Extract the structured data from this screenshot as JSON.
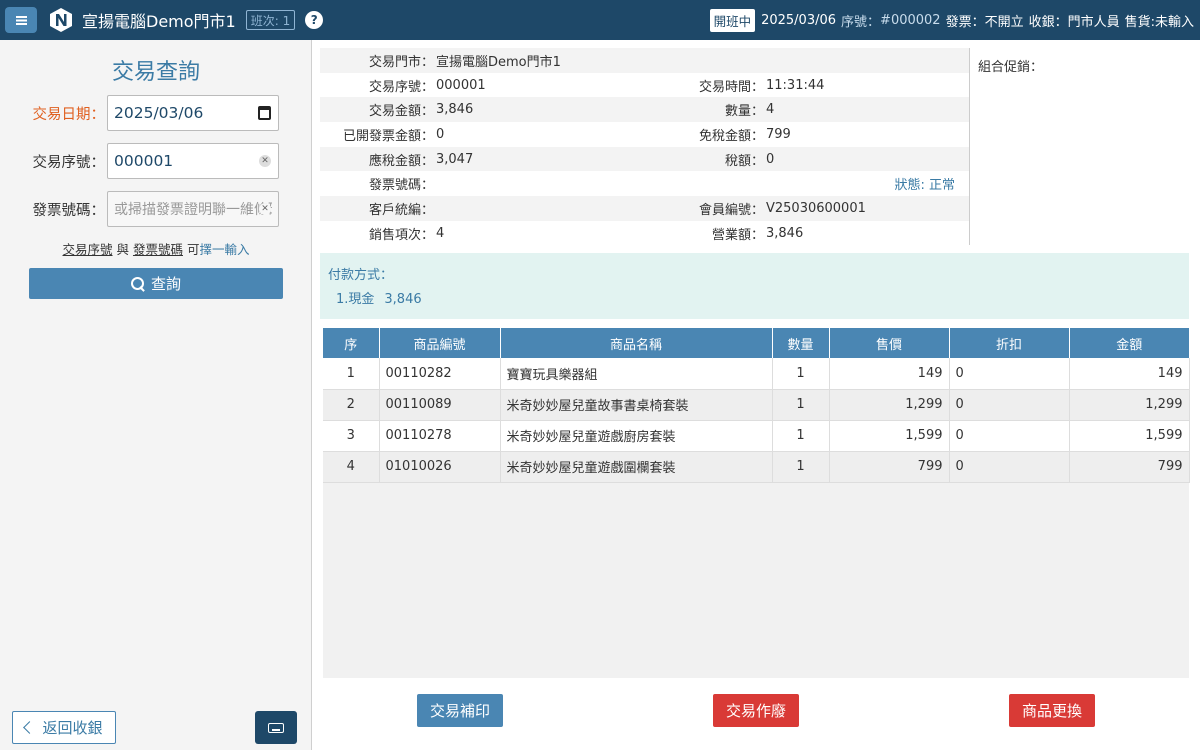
{
  "header": {
    "app_title": "宣揚電腦Demo門市1",
    "shift_badge": "班次: 1",
    "help": "?",
    "shift_status": "開班中",
    "date": "2025/03/06",
    "serial_label": "序號：",
    "serial_value": "#000002",
    "invoice": "發票：不開立",
    "cashier": "收銀：門市人員",
    "sales": "售貨:未輸入"
  },
  "sidebar": {
    "title": "交易查詢",
    "date_label": "交易日期：",
    "date_value": "2025/03/06",
    "serial_label": "交易序號：",
    "serial_value": "000001",
    "invoice_label": "發票號碼：",
    "invoice_placeholder": "或掃描發票證明聯一維條碼",
    "hint_part1": "交易序號",
    "hint_and": " 與 ",
    "hint_part2": "發票號碼",
    "hint_can": " 可",
    "hint_choose": "擇一輸入",
    "query_button": "查詢",
    "back_button": "返回收銀"
  },
  "info": {
    "store_label": "交易門市：",
    "store_value": "宣揚電腦Demo門市1",
    "serial_label": "交易序號：",
    "serial_value": "000001",
    "time_label": "交易時間：",
    "time_value": "11:31:44",
    "amount_label": "交易金額：",
    "amount_value": "3,846",
    "qty_label": "數量：",
    "qty_value": "4",
    "invoiced_label": "已開發票金額：",
    "invoiced_value": "0",
    "taxfree_label": "免稅金額：",
    "taxfree_value": "799",
    "taxable_label": "應稅金額：",
    "taxable_value": "3,047",
    "tax_label": "稅額：",
    "tax_value": "0",
    "invoice_no_label": "發票號碼：",
    "status": "狀態: 正常",
    "customer_label": "客戶統編：",
    "member_label": "會員編號：",
    "member_value": "V25030600001",
    "items_label": "銷售項次：",
    "items_value": "4",
    "revenue_label": "營業額：",
    "revenue_value": "3,846",
    "promo_label": "組合促銷："
  },
  "payment": {
    "title": "付款方式：",
    "method": "1.現金",
    "amount": "3,846"
  },
  "table": {
    "headers": [
      "序",
      "商品編號",
      "商品名稱",
      "數量",
      "售價",
      "折扣",
      "金額"
    ],
    "rows": [
      [
        "1",
        "00110282",
        "寶寶玩具樂器組",
        "1",
        "149",
        "0",
        "149"
      ],
      [
        "2",
        "00110089",
        "米奇妙妙屋兒童故事書桌椅套裝",
        "1",
        "1,299",
        "0",
        "1,299"
      ],
      [
        "3",
        "00110278",
        "米奇妙妙屋兒童遊戲廚房套裝",
        "1",
        "1,599",
        "0",
        "1,599"
      ],
      [
        "4",
        "01010026",
        "米奇妙妙屋兒童遊戲圍欄套裝",
        "1",
        "799",
        "0",
        "799"
      ]
    ]
  },
  "actions": {
    "reprint": "交易補印",
    "void": "交易作廢",
    "exchange": "商品更換"
  }
}
